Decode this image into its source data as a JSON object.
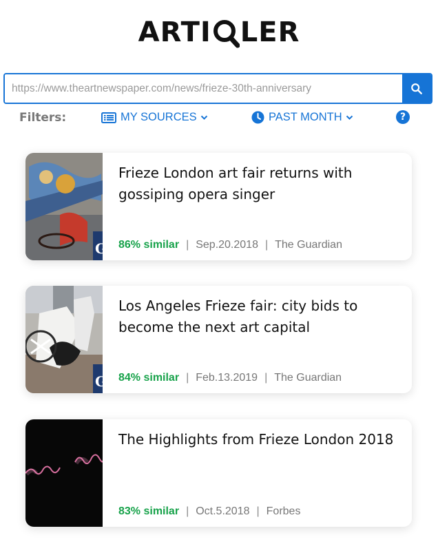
{
  "logo": {
    "before": "ARTI",
    "after": "LER",
    "icon": "magnifier-q-icon"
  },
  "search": {
    "value": "https://www.theartnewspaper.com/news/frieze-30th-anniversary",
    "icon": "search-icon"
  },
  "filters": {
    "label": "Filters:",
    "sources": {
      "label": "MY SOURCES",
      "icon": "list-icon"
    },
    "time": {
      "label": "PAST MONTH",
      "icon": "clock-icon"
    },
    "help": "?"
  },
  "articles": [
    {
      "title": "Frieze London art fair returns with gossiping opera singer",
      "similarity": "86% similar",
      "date": "Sep.20.2018",
      "source": "The Guardian"
    },
    {
      "title": "Los Angeles Frieze fair: city bids to become the next art capital",
      "similarity": "84% similar",
      "date": "Feb.13.2019",
      "source": "The Guardian"
    },
    {
      "title": "The Highlights from Frieze London 2018",
      "similarity": "83% similar",
      "date": "Oct.5.2018",
      "source": "Forbes"
    }
  ],
  "colors": {
    "accent": "#1674d6",
    "similar": "#17a24a",
    "muted": "#777777"
  }
}
